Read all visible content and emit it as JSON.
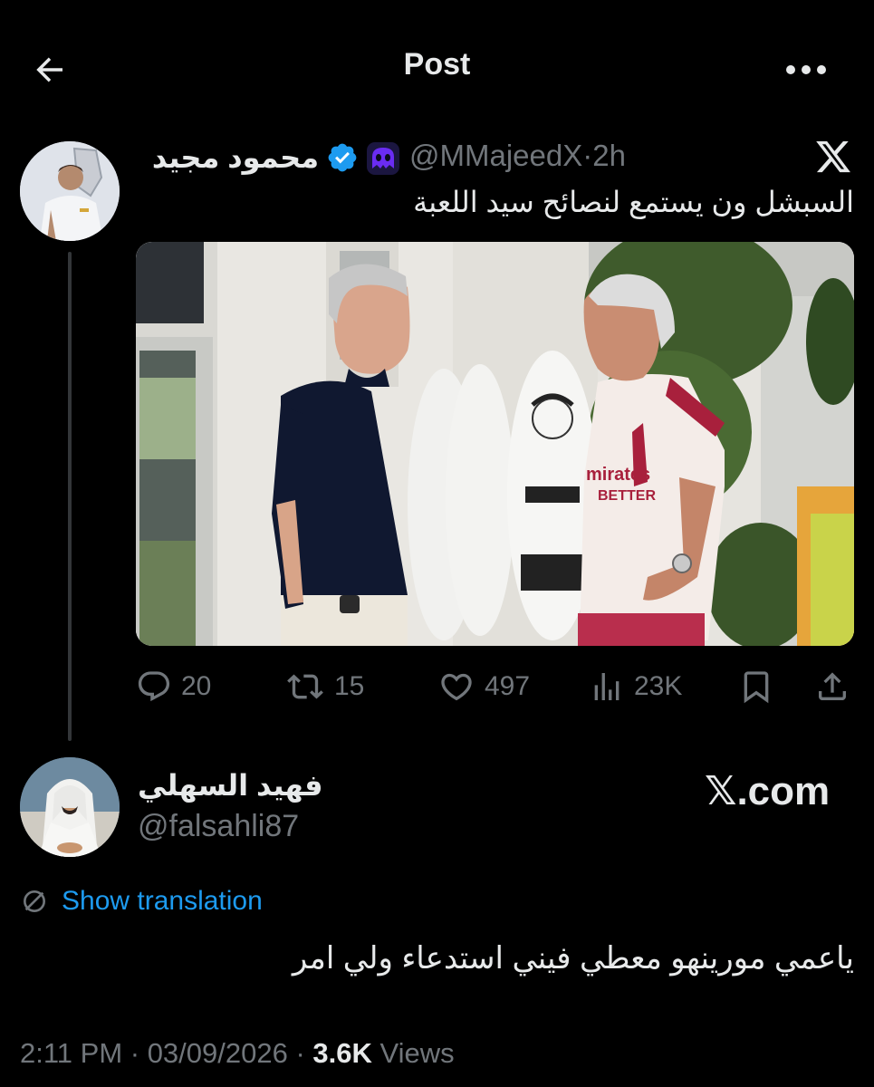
{
  "header": {
    "title": "Post",
    "back_icon": "arrow-left-icon",
    "more_icon": "more-horizontal-icon"
  },
  "tweet": {
    "author_name": "محمود مجيد",
    "handle": "@MMajeedX",
    "separator": "·",
    "time": "2h",
    "text": "السبشل ون يستمع لنصائح سيد اللعبة",
    "verified_color": "#1d9bf0",
    "actions": {
      "replies": "20",
      "reposts": "15",
      "likes": "497",
      "views": "23K"
    }
  },
  "reply": {
    "author_name": "فهيد السهلي",
    "handle": "@falsahli87",
    "watermark": "𝕏.com",
    "show_translation": "Show translation",
    "text": "ياعمي مورينهو معطي فيني استدعاء ولي امر",
    "timestamp": "2:11 PM · 03/09/2026 · ",
    "views_count": "3.6K",
    "views_label": " Views"
  },
  "colors": {
    "background": "#000000",
    "text": "#e7e9ea",
    "muted": "#71767b",
    "link": "#1d9bf0"
  }
}
